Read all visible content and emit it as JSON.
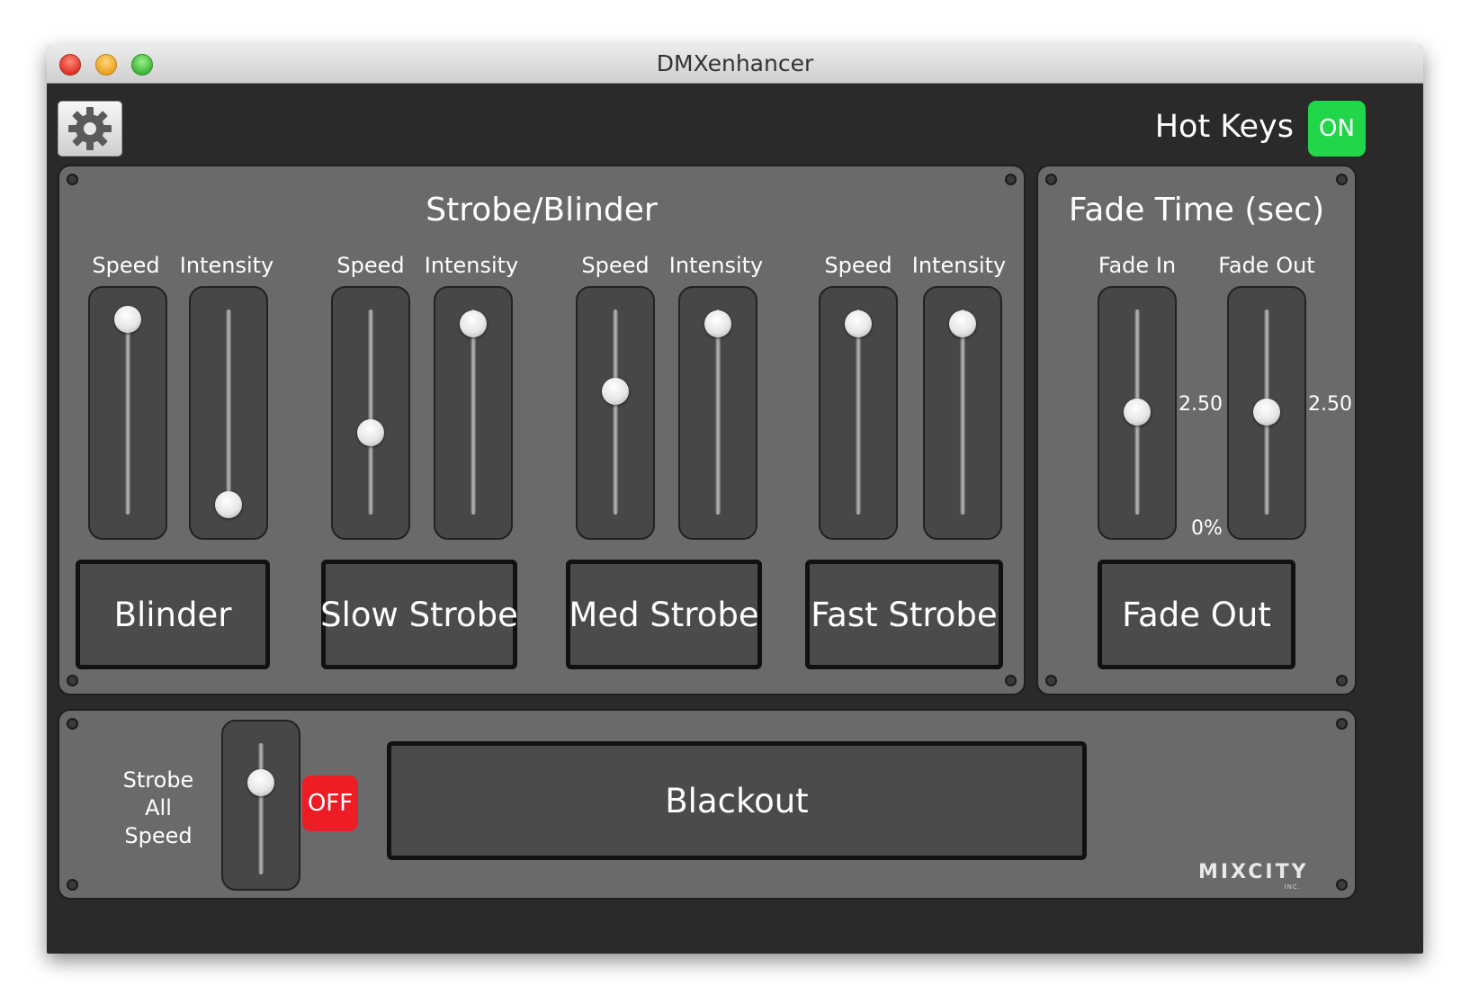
{
  "window": {
    "title": "DMXenhancer"
  },
  "header": {
    "settings_icon": "gear-icon",
    "hotkeys_label": "Hot Keys",
    "hotkeys_state": "ON",
    "hotkeys_color": "#22d64a"
  },
  "strobe_panel": {
    "title": "Strobe/Blinder",
    "groups": [
      {
        "speed_label": "Speed",
        "intensity_label": "Intensity",
        "speed_value": 0.95,
        "intensity_value": 0.05,
        "button": "Blinder"
      },
      {
        "speed_label": "Speed",
        "intensity_label": "Intensity",
        "speed_value": 0.4,
        "intensity_value": 0.93,
        "button": "Slow Strobe"
      },
      {
        "speed_label": "Speed",
        "intensity_label": "Intensity",
        "speed_value": 0.6,
        "intensity_value": 0.93,
        "button": "Med Strobe"
      },
      {
        "speed_label": "Speed",
        "intensity_label": "Intensity",
        "speed_value": 0.93,
        "intensity_value": 0.93,
        "button": "Fast Strobe"
      }
    ]
  },
  "fade_panel": {
    "title": "Fade Time (sec)",
    "fade_in_label": "Fade In",
    "fade_out_label": "Fade Out",
    "fade_in_value": "2.50",
    "fade_out_value": "2.50",
    "fade_in_level": 0.5,
    "fade_out_level": 0.5,
    "min_label": "0%",
    "button": "Fade Out"
  },
  "bottom_panel": {
    "strobe_all_label_1": "Strobe",
    "strobe_all_label_2": "All",
    "strobe_all_label_3": "Speed",
    "strobe_all_level": 0.7,
    "strobe_all_state": "OFF",
    "off_color": "#ee1c24",
    "blackout_button": "Blackout",
    "logo_text": "MIXCITY",
    "logo_sub": "INC."
  }
}
